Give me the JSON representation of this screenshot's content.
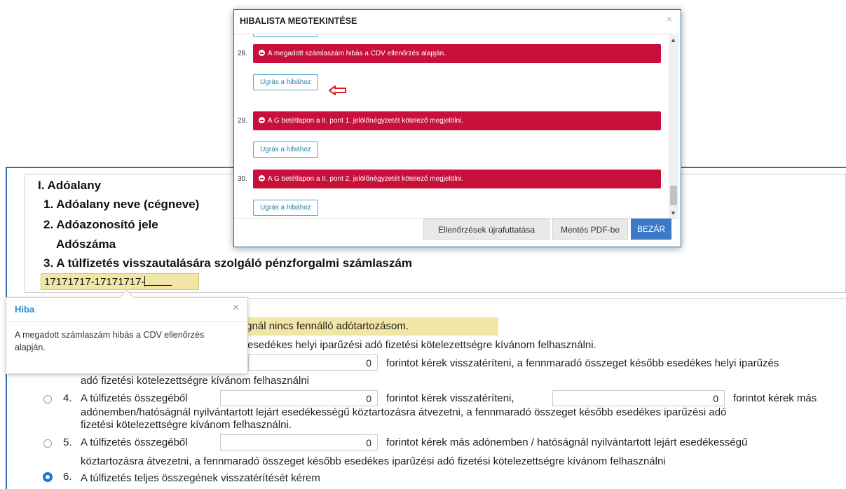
{
  "form": {
    "section_title": "I. Adóalany",
    "field1_label": "1. Adóalany neve (cégneve)",
    "field2_label": "2. Adóazonosító jele",
    "field2_sub_label": "Adószáma",
    "field3_label": "3. A túlfizetés visszautalására szolgáló pénzforgalmi számlaszám",
    "account_value": "17171717-17171717-",
    "highlight_text": "óságnál nincs fennálló adótartozásom.",
    "line_a": "esedékes helyi iparűzési adó fizetési kötelezettségre kívánom felhasználni.",
    "option3_amount": "0",
    "option3_text": "forintot kérek visszatéríteni, a fennmaradó összeget később esedékes helyi iparűzés",
    "option3_cont": "adó fizetési kötelezettségre kívánom felhasználni",
    "option4_num": "4.",
    "option4_text": "A túlfizetés összegéből",
    "option4_amount1": "0",
    "option4_mid": "forintot kérek visszatéríteni,",
    "option4_amount2": "0",
    "option4_end": "forintot kérek más",
    "option4_line2": "adónemben/hatóságnál nyilvántartott lejárt esedékességű köztartozásra átvezetni, a fennmaradó összeget később esedékes iparűzési adó",
    "option4_line3": "fizetési kötelezettségre kívánom felhasználni.",
    "option5_num": "5.",
    "option5_text": "A túlfizetés összegéből",
    "option5_amount": "0",
    "option5_end": "forintot kérek más adónemben / hatóságnál nyilvántartott lejárt esedékességű",
    "option5_line2": "köztartozásra átvezetni, a fennmaradó összeget később esedékes iparűzési adó fizetési kötelezettségre kívánom felhasználni",
    "option6_num": "6.",
    "option6_text": "A túlfizetés teljes összegének visszatérítését kérem"
  },
  "tooltip": {
    "title": "Hiba",
    "close": "×",
    "body": "A megadott számlaszám hibás a CDV ellenőrzés alapján."
  },
  "modal": {
    "title": "HIBALISTA MEGTEKINTÉSE",
    "close": "×",
    "errors": [
      {
        "num": "28.",
        "message": "A megadott számlaszám hibás a CDV ellenőrzés alapján.",
        "button": "Ugrás a hibához"
      },
      {
        "num": "29.",
        "message": "A G betétlapon a II. pont 1. jelölőnégyzetét kötelező megjelölni.",
        "button": "Ugrás a hibához"
      },
      {
        "num": "30.",
        "message": "A G betétlapon a II. pont 2. jelölőnégyzetét kötelező megjelölni.",
        "button": "Ugrás a hibához"
      }
    ],
    "footer": {
      "rerun_label": "Ellenőrzések újrafuttatása",
      "pdf_label": "Mentés PDF-be",
      "close_label": "BEZÁR"
    }
  },
  "colors": {
    "error_red": "#c8103b",
    "primary_blue": "#3b79c9",
    "highlight_yellow": "#f2e6a6",
    "link_teal": "#2b7fa6"
  }
}
